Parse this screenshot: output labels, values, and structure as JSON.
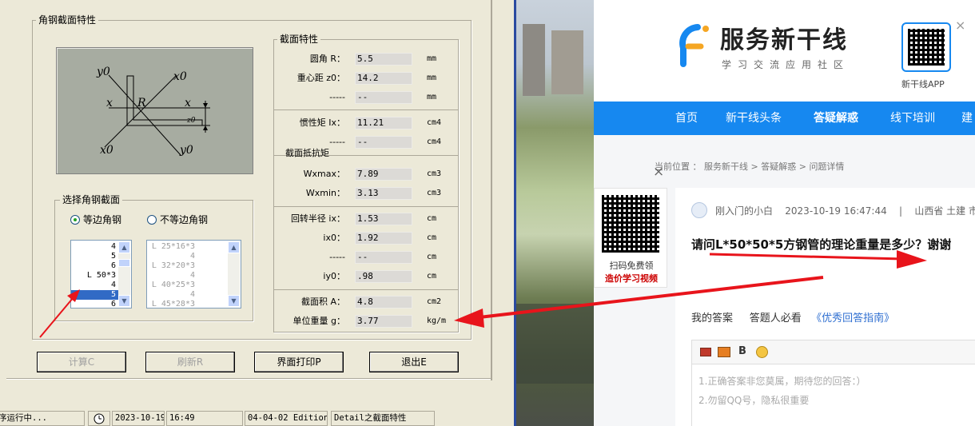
{
  "app": {
    "outer_group_title": "角钢截面特性",
    "diagram": {
      "y0_top": "y0",
      "x0_top": "x0",
      "x_left": "x",
      "R": "R",
      "x_right": "x",
      "z0": "z0",
      "x0_bottom": "x0",
      "y0_bottom": "y0"
    },
    "select_group": {
      "title": "选择角钢截面",
      "radio_equal": "等边角钢",
      "radio_unequal": "不等边角钢",
      "list_equal": [
        "4",
        "5",
        "6",
        "L 50*3",
        "4",
        "5",
        "6"
      ],
      "list_equal_selected_index": 5,
      "list_unequal": [
        "L 25*16*3",
        "4",
        "L 32*20*3",
        "4",
        "L 40*25*3",
        "4",
        "L 45*28*3"
      ]
    },
    "props": {
      "title": "截面特性",
      "rows": [
        {
          "label": "圆角   R：",
          "value": "5.5",
          "unit": "mm"
        },
        {
          "label": "重心距 z0：",
          "value": "14.2",
          "unit": "mm"
        },
        {
          "label": "-----",
          "value": "--",
          "unit": "mm"
        },
        {
          "label": "惯性矩 Ix：",
          "value": "11.21",
          "unit": "cm4"
        },
        {
          "label": "-----",
          "value": "--",
          "unit": "cm4"
        },
        {
          "label": "Wxmax：",
          "value": "7.89",
          "unit": "cm3"
        },
        {
          "label": "Wxmin：",
          "value": "3.13",
          "unit": "cm3"
        },
        {
          "label": "回转半径 ix：",
          "value": "1.53",
          "unit": "cm"
        },
        {
          "label": "ix0：",
          "value": "1.92",
          "unit": "cm"
        },
        {
          "label": "-----",
          "value": "--",
          "unit": "cm"
        },
        {
          "label": "iy0：",
          "value": ".98",
          "unit": "cm"
        },
        {
          "label": "截面积 A：",
          "value": "4.8",
          "unit": "cm2"
        },
        {
          "label": "单位重量 g：",
          "value": "3.77",
          "unit": "kg/m"
        }
      ],
      "subheader": "截面抵抗矩"
    },
    "buttons": {
      "calc": "计算C",
      "refresh": "刷新R",
      "print": "界面打印P",
      "exit": "退出E"
    },
    "status": {
      "s1": "序运行中...",
      "date": "2023-10-19",
      "time": "16:49",
      "edition": "04-04-02 Edition",
      "detail": "Detail之截面特性"
    }
  },
  "web": {
    "logo_text": "服务新干线",
    "logo_sub": "学习交流应用社区",
    "qr_caption": "新干线APP",
    "close": "×",
    "nav": [
      "首页",
      "新干线头条",
      "答疑解惑",
      "线下培训",
      "建"
    ],
    "breadcrumb": {
      "prefix": "当前位置 ：",
      "home": "服务新干线",
      "sep1": ">",
      "section": "答疑解惑",
      "sep2": ">",
      "page": "问题详情"
    },
    "side_close": "×",
    "side_qr_caption1": "扫码免费领",
    "side_qr_caption2": "造价学习视频",
    "question": {
      "user": "刚入门的小白",
      "time": "2023-10-19 16:47:44",
      "divider": "|",
      "region": "山西省 土建 市",
      "title": "请问L*50*50*5方钢管的理论重量是多少？谢谢"
    },
    "answer_tabs": {
      "mine": "我的答案",
      "must_see": "答题人必看",
      "guide": "《优秀回答指南》"
    },
    "editor": {
      "bold": "B",
      "placeholder1": "1.正确答案非您莫属，期待您的回答：）",
      "placeholder2": "2.勿留QQ号，隐私很重要"
    }
  },
  "colors": {
    "nav_blue": "#1688f0",
    "arrow_red": "#e8141b",
    "selection_blue": "#316ac5",
    "guide_blue": "#2f6fd1"
  }
}
